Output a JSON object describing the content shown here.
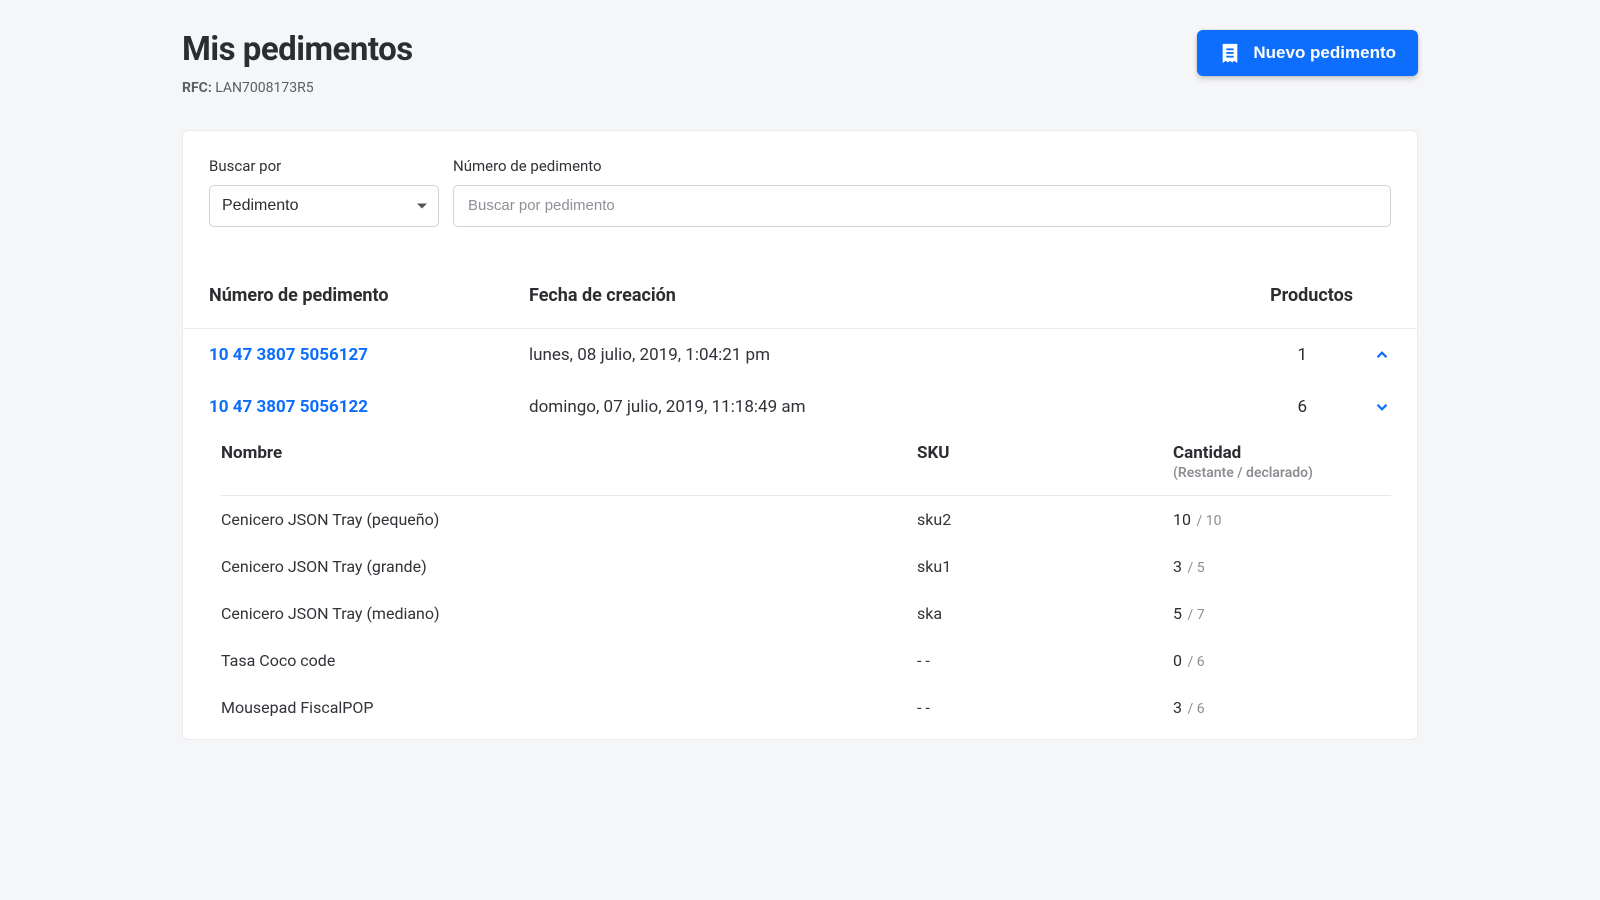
{
  "header": {
    "title": "Mis pedimentos",
    "rfc_label": "RFC:",
    "rfc_value": "LAN7008173R5",
    "new_button": "Nuevo pedimento"
  },
  "filters": {
    "search_by_label": "Buscar por",
    "search_by_value": "Pedimento",
    "number_label": "Número de pedimento",
    "number_placeholder": "Buscar por pedimento"
  },
  "columns": {
    "number": "Número de pedimento",
    "created": "Fecha de creación",
    "products": "Productos"
  },
  "expanded_columns": {
    "name": "Nombre",
    "sku": "SKU",
    "qty": "Cantidad",
    "qty_sub": "(Restante / declarado)"
  },
  "rows": [
    {
      "number": "10 47 3807 5056127",
      "created": "lunes, 08 julio, 2019, 1:04:21 pm",
      "products": "1",
      "expanded": false
    },
    {
      "number": "10 47 3807 5056122",
      "created": "domingo, 07 julio, 2019, 11:18:49 am",
      "products": "6",
      "expanded": true,
      "items": [
        {
          "name": "Cenicero JSON Tray (pequeño)",
          "sku": "sku2",
          "qty_main": "10",
          "qty_of": "10"
        },
        {
          "name": "Cenicero JSON Tray (grande)",
          "sku": "sku1",
          "qty_main": "3",
          "qty_of": "5"
        },
        {
          "name": "Cenicero JSON Tray (mediano)",
          "sku": "ska",
          "qty_main": "5",
          "qty_of": "7"
        },
        {
          "name": "Tasa Coco code",
          "sku": "- -",
          "qty_main": "0",
          "qty_of": "6"
        },
        {
          "name": "Mousepad FiscalPOP",
          "sku": "- -",
          "qty_main": "3",
          "qty_of": "6"
        }
      ]
    }
  ]
}
